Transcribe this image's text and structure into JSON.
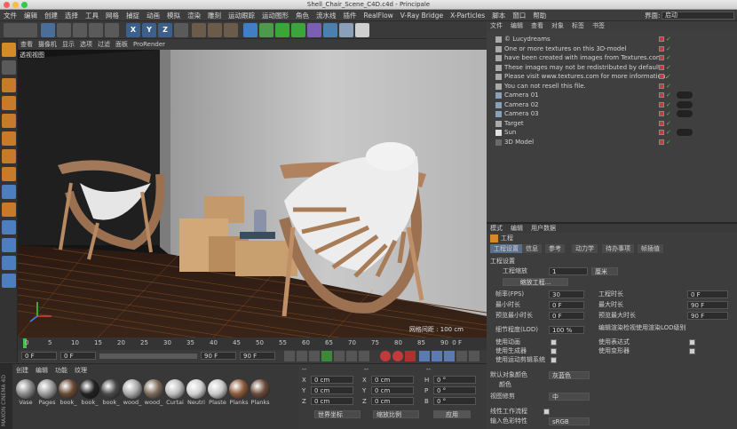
{
  "window": {
    "title": "Shell_Chair_Scene_C4D.c4d - Principale"
  },
  "menubar": {
    "items": [
      "文件",
      "编辑",
      "创建",
      "选择",
      "工具",
      "网格",
      "捕捉",
      "动画",
      "模拟",
      "渲染",
      "雕刻",
      "运动跟踪",
      "运动图形",
      "角色",
      "流水线",
      "插件",
      "RealFlow",
      "V-Ray Bridge",
      "X-Particles",
      "脚本",
      "窗口",
      "帮助"
    ],
    "layout_label": "界面:",
    "layout_value": "启动"
  },
  "viewport": {
    "menu": [
      "查看",
      "摄像机",
      "显示",
      "选项",
      "过滤",
      "面板",
      "ProRender"
    ],
    "label": "透视视图",
    "grid_info": "网格间距 : 100 cm"
  },
  "timeline": {
    "ticks": [
      "0",
      "5",
      "10",
      "15",
      "20",
      "25",
      "30",
      "35",
      "40",
      "45",
      "50",
      "55",
      "60",
      "65",
      "70",
      "75",
      "80",
      "85",
      "90"
    ],
    "end_label": "0 F"
  },
  "transport": {
    "start_field": "0 F",
    "min_field": "0 F",
    "max_field": "90 F",
    "end_field": "90 F"
  },
  "materials": {
    "menu": [
      "创建",
      "编辑",
      "功能",
      "纹理"
    ],
    "items": [
      "Vase",
      "Pages",
      "book_",
      "book_",
      "book_",
      "wood_",
      "wood_",
      "Curtai",
      "Neutri",
      "Plaste",
      "Planks",
      "Planks"
    ],
    "brand": "MAXON CINEMA 4D"
  },
  "coordinates": {
    "rows": [
      {
        "axis": "X",
        "pos": "0 cm",
        "axis2": "X",
        "size": "0 cm",
        "axis3": "H",
        "rot": "0 °"
      },
      {
        "axis": "Y",
        "pos": "0 cm",
        "axis2": "Y",
        "size": "0 cm",
        "axis3": "P",
        "rot": "0 °"
      },
      {
        "axis": "Z",
        "pos": "0 cm",
        "axis2": "Z",
        "size": "0 cm",
        "axis3": "B",
        "rot": "0 °"
      }
    ],
    "dash1": "--",
    "dash2": "--",
    "dash3": "--",
    "mode1": "世界坐标",
    "mode2": "缩放比例",
    "apply": "应用"
  },
  "object_manager": {
    "menu": [
      "文件",
      "编辑",
      "查看",
      "对象",
      "标签",
      "书签"
    ],
    "objects": [
      "© Lucydreams",
      "One or more textures on this 3D-model",
      "have been created with images from Textures.com.",
      "These images may not be redistributed by default.",
      "Please visit www.textures.com for more information.",
      "You can not resell this file.",
      "Camera 01",
      "Camera 02",
      "Camera 03",
      "Target",
      "Sun",
      "3D Model"
    ]
  },
  "attributes": {
    "menu": [
      "模式",
      "编辑",
      "用户数据"
    ],
    "title": "工程",
    "tabs": [
      "工程设置",
      "信息",
      "参考",
      "动力学",
      "待办事项",
      "帧插值"
    ],
    "section": "工程设置",
    "scale_label": "工程缩放",
    "scale_value": "1",
    "scale_unit": "厘米",
    "scale_button": "缩放工程...",
    "fields": [
      {
        "label": "帧率(FPS)",
        "value": "30"
      },
      {
        "label": "最小时长",
        "value": "0 F"
      },
      {
        "label": "预览最小时长",
        "value": "0 F"
      },
      {
        "label": "细节程度(LOD)",
        "value": "100 %"
      }
    ],
    "fields_right": [
      {
        "label": "工程时长",
        "value": "0 F"
      },
      {
        "label": "最大时长",
        "value": "90 F"
      },
      {
        "label": "预览最大时长",
        "value": "90 F"
      }
    ],
    "lod_note": "编辑渲染检视使用渲染LOD级别",
    "checks_left": [
      "使用动画",
      "使用生成器",
      "使用运动剪辑系统"
    ],
    "checks_right": [
      "使用表达式",
      "使用变形器"
    ],
    "default_color_label": "默认对象颜色",
    "default_color_value": "灰蓝色",
    "color_label": "颜色",
    "view_clip_label": "视图修剪",
    "view_clip_value": "中",
    "linear_label": "线性工作流程",
    "input_color_label": "输入色彩特性",
    "input_color_value": "sRGB"
  }
}
